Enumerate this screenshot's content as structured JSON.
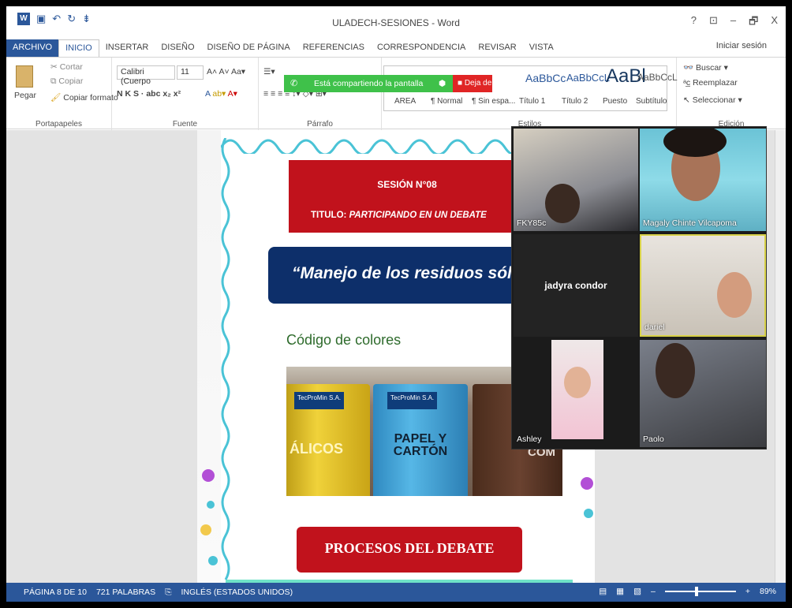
{
  "window": {
    "title": "ULADECH-SESIONES - Word",
    "controls": [
      "?",
      "⊡",
      "–",
      "🗗",
      "X"
    ],
    "signin": "Iniciar sesión"
  },
  "tabs": [
    "ARCHIVO",
    "INICIO",
    "INSERTAR",
    "DISEÑO",
    "DISEÑO DE PÁGINA",
    "REFERENCIAS",
    "CORRESPONDENCIA",
    "REVISAR",
    "VISTA"
  ],
  "ribbon": {
    "clipboard": {
      "paste": "Pegar",
      "cut": "Cortar",
      "copy": "Copiar",
      "format_painter": "Copiar formato",
      "label": "Portapapeles"
    },
    "font": {
      "name": "Calibri (Cuerpo",
      "size": "11",
      "label": "Fuente",
      "row2": "N  K  S  ·  abc  x₂  x²"
    },
    "paragraph": {
      "label": "Párrafo"
    },
    "styles": {
      "label": "Estilos",
      "items": [
        {
          "sample": "AaBbCcDc",
          "name": "AREA"
        },
        {
          "sample": "AaBbCcDc",
          "name": "¶ Normal"
        },
        {
          "sample": "AaBbCcDc",
          "name": "¶ Sin espa..."
        },
        {
          "sample": "AaBbCc",
          "name": "Título 1"
        },
        {
          "sample": "AaBbCcL",
          "name": "Título 2"
        },
        {
          "sample": "AaBl",
          "name": "Puesto"
        },
        {
          "sample": "AaBbCcL",
          "name": "Subtítulo"
        }
      ]
    },
    "editing": {
      "find": "Buscar",
      "replace": "Reemplazar",
      "select": "Seleccionar",
      "label": "Edición"
    }
  },
  "share_bar": {
    "text": "Está compartiendo la pantalla",
    "stop": "Deja de"
  },
  "document": {
    "session": "SESIÓN N°08",
    "title_prefix": "TITULO:",
    "title_value": "PARTICIPANDO EN UN DEBATE",
    "topic": "“Manejo de los residuos sólidos",
    "colors_title": "Código de colores",
    "bins": {
      "yellow": "ÁLICOS",
      "blue": "PAPEL Y CARTÓN",
      "brown": "COM",
      "tag": "TecProMin S.A."
    },
    "debate": "PROCESOS DEL DEBATE"
  },
  "video": {
    "participants": [
      {
        "name": "FKY85c"
      },
      {
        "name": "Magaly Chinte Vilcapoma"
      },
      {
        "name": "jadyra condor"
      },
      {
        "name": "dariel"
      },
      {
        "name": "Ashley"
      },
      {
        "name": "Paolo"
      }
    ]
  },
  "status": {
    "page": "PÁGINA 8 DE 10",
    "words": "721 PALABRAS",
    "language": "INGLÉS (ESTADOS UNIDOS)",
    "zoom": "89%"
  },
  "colors": {
    "word_blue": "#2b579a",
    "share_green": "#3fc14a",
    "stop_red": "#e02525",
    "session_red": "#c1121c",
    "topic_navy": "#0d2f6a"
  }
}
